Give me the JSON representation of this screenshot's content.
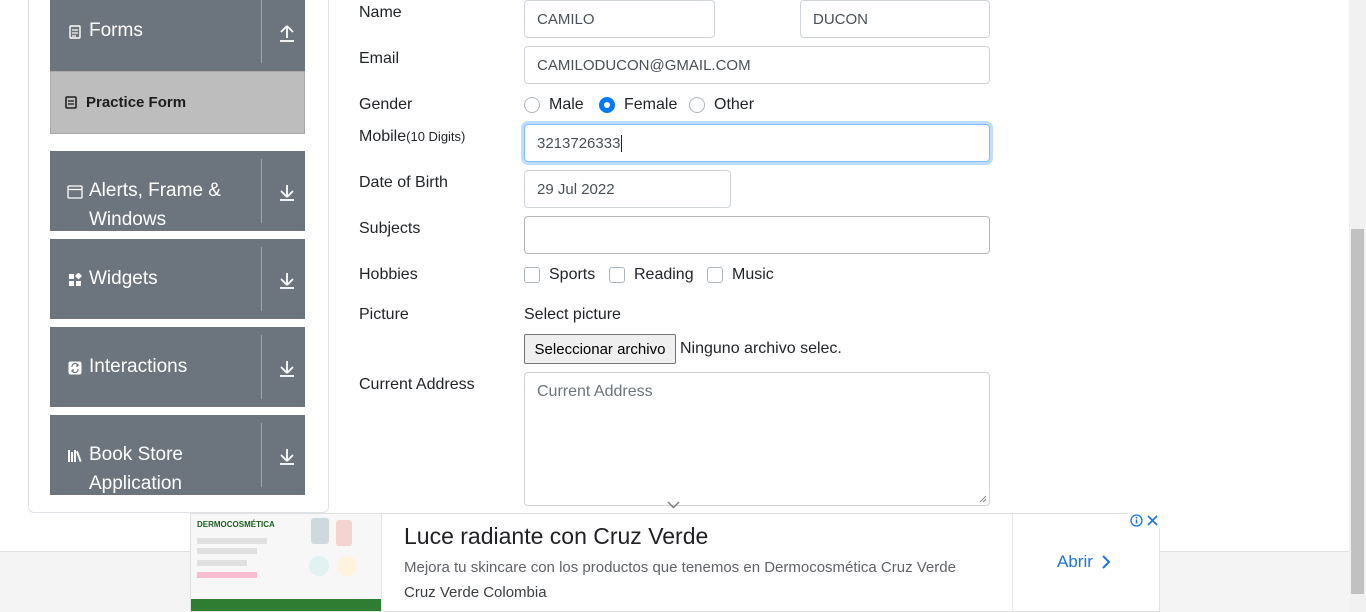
{
  "sidebar": {
    "groups": [
      {
        "label": "Forms",
        "icon": "form-icon",
        "arrow": "arrow-up-icon"
      },
      {
        "label": "Alerts, Frame &",
        "label2": "Windows",
        "icon": "window-icon",
        "arrow": "arrow-down-icon"
      },
      {
        "label": "Widgets",
        "icon": "widgets-icon",
        "arrow": "arrow-down-icon"
      },
      {
        "label": "Interactions",
        "icon": "interactions-icon",
        "arrow": "arrow-down-icon"
      },
      {
        "label": "Book Store",
        "label2": "Application",
        "icon": "books-icon",
        "arrow": "arrow-down-icon"
      }
    ],
    "active_item": {
      "label": "Practice Form",
      "icon": "form-icon"
    }
  },
  "form": {
    "name_label": "Name",
    "first_name": "CAMILO",
    "last_name": "DUCON",
    "email_label": "Email",
    "email": "CAMILODUCON@GMAIL.COM",
    "gender_label": "Gender",
    "genders": [
      "Male",
      "Female",
      "Other"
    ],
    "gender_selected": "Female",
    "mobile_label": "Mobile",
    "mobile_hint": "(10 Digits)",
    "mobile": "3213726333",
    "dob_label": "Date of Birth",
    "dob": "29 Jul 2022",
    "subjects_label": "Subjects",
    "subjects": "",
    "hobbies_label": "Hobbies",
    "hobbies": [
      "Sports",
      "Reading",
      "Music"
    ],
    "picture_label": "Picture",
    "select_picture": "Select picture",
    "file_button": "Seleccionar archivo",
    "file_none": "Ninguno archivo selec.",
    "address_label": "Current Address",
    "address_placeholder": "Current Address"
  },
  "ad": {
    "brand_text": "DERMOCOSMÉTICA",
    "title": "Luce radiante con Cruz Verde",
    "description": "Mejora tu skincare con los productos que tenemos en Dermocosmética Cruz Verde",
    "source": "Cruz Verde Colombia",
    "cta": "Abrir"
  },
  "colors": {
    "sidebar_group": "#6c757d",
    "active_item": "#bdbdbd",
    "accent": "#007bff",
    "link": "#1a73e8"
  }
}
